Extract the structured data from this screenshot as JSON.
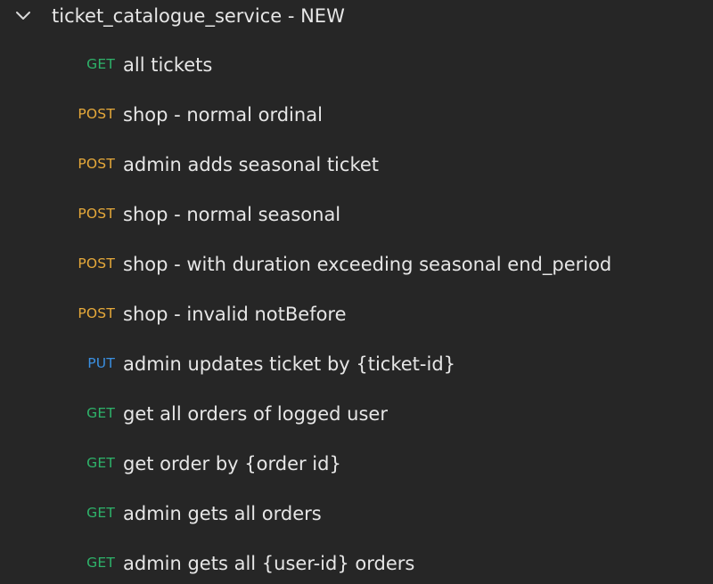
{
  "collection": {
    "name": "ticket_catalogue_service - NEW",
    "expanded_icon": "chevron-down-icon"
  },
  "method_colors": {
    "GET": "#2eb36a",
    "POST": "#e6a93a",
    "PUT": "#3a8fe0"
  },
  "requests": [
    {
      "method": "GET",
      "name": "all tickets"
    },
    {
      "method": "POST",
      "name": "shop - normal ordinal"
    },
    {
      "method": "POST",
      "name": "admin adds seasonal ticket"
    },
    {
      "method": "POST",
      "name": "shop - normal seasonal"
    },
    {
      "method": "POST",
      "name": "shop - with duration exceeding seasonal end_period"
    },
    {
      "method": "POST",
      "name": "shop - invalid notBefore"
    },
    {
      "method": "PUT",
      "name": "admin updates ticket by {ticket-id}"
    },
    {
      "method": "GET",
      "name": "get all orders of logged user"
    },
    {
      "method": "GET",
      "name": "get order by {order id}"
    },
    {
      "method": "GET",
      "name": "admin gets all orders"
    },
    {
      "method": "GET",
      "name": "admin gets all {user-id} orders"
    }
  ]
}
